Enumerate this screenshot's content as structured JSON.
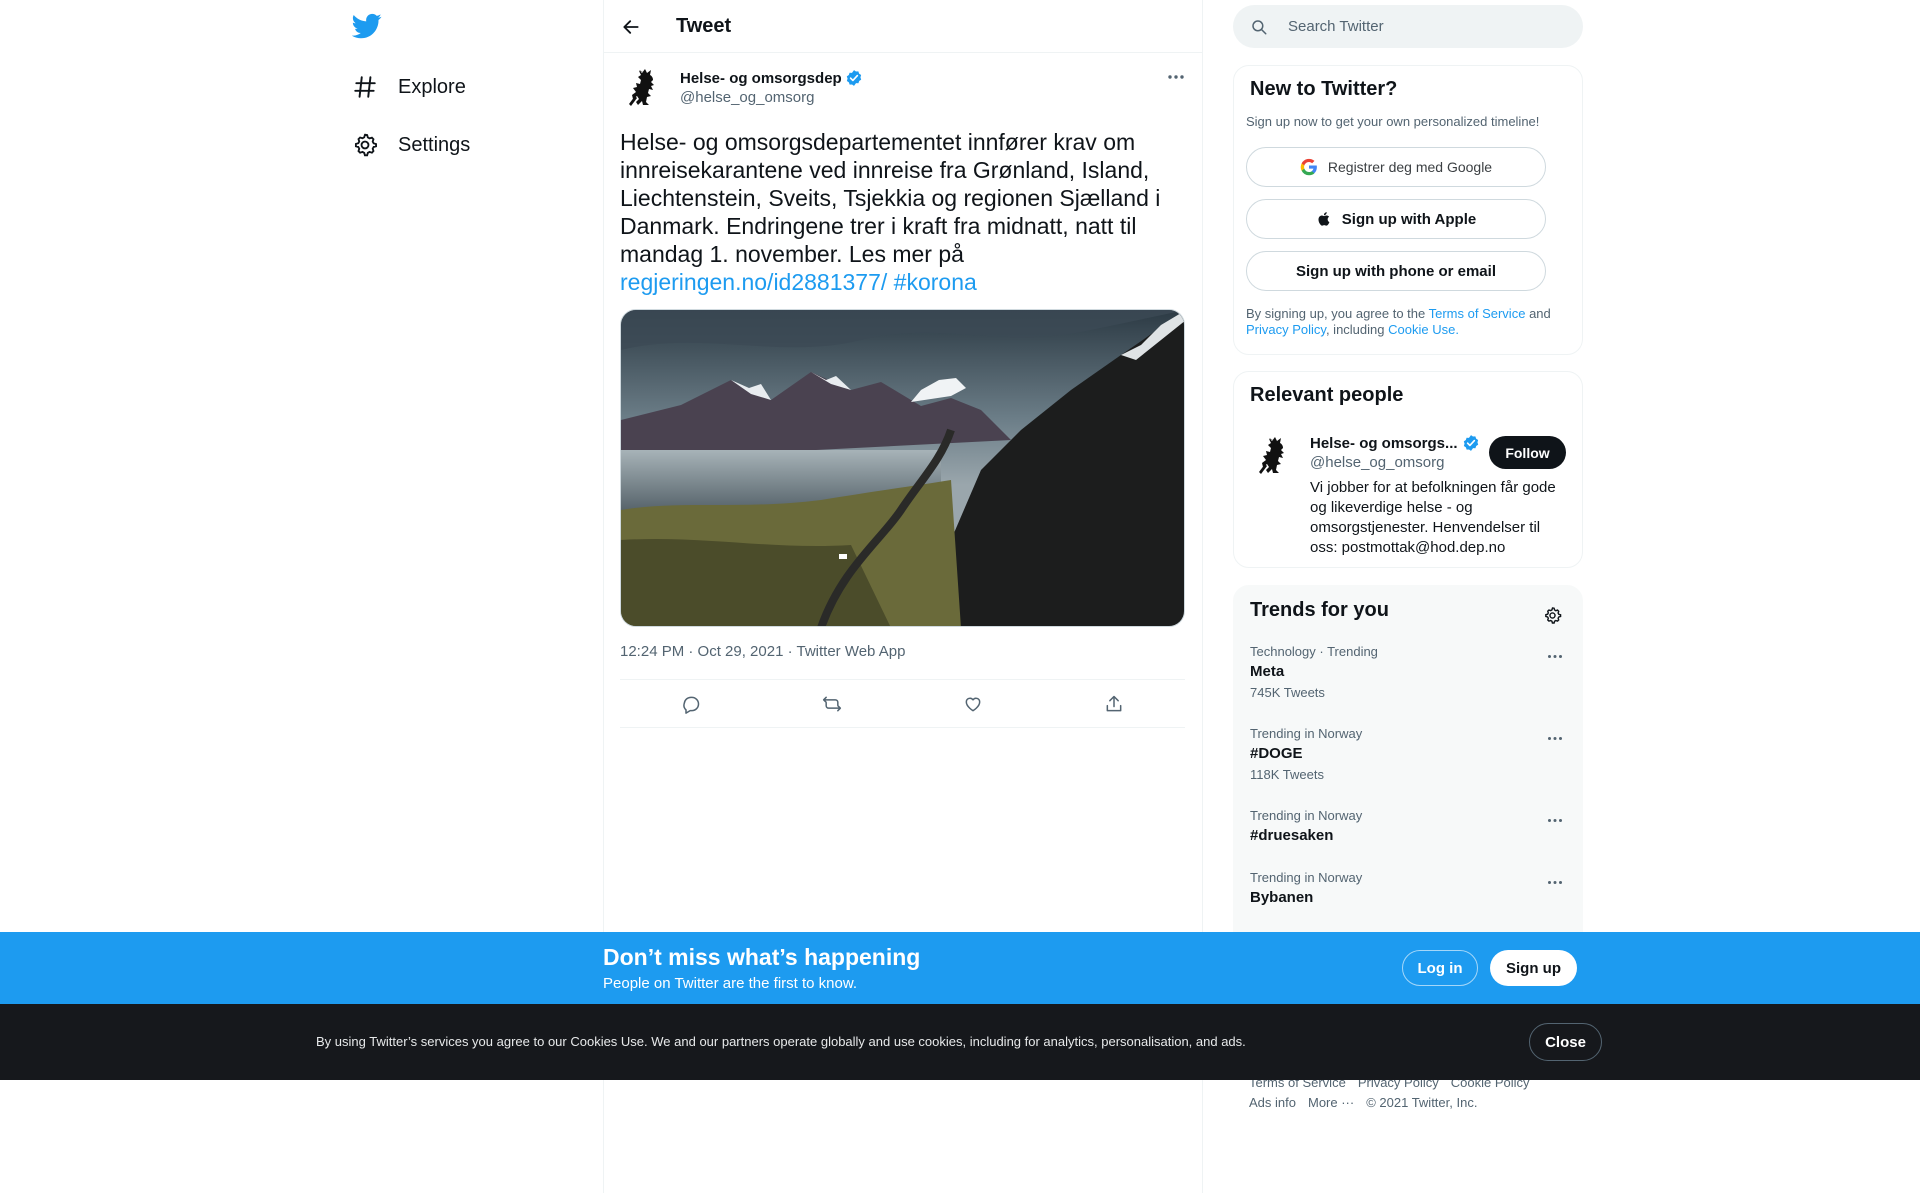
{
  "nav": {
    "items": [
      {
        "label": "Explore",
        "icon": "hashtag-icon"
      },
      {
        "label": "Settings",
        "icon": "gear-icon"
      }
    ]
  },
  "header": {
    "title": "Tweet"
  },
  "tweet": {
    "author_name": "Helse- og omsorgsdep",
    "author_handle": "@helse_og_omsorg",
    "text": "Helse- og omsorgsdepartementet innfører krav om innreisekarantene ved innreise fra Grønland, Island, Liechtenstein, Sveits, Tsjekkia og regionen Sjælland i Danmark. Endringene trer i kraft fra midnatt, natt til mandag 1. november. Les mer på",
    "link": "regjeringen.no/id2881377/",
    "hashtag": "#korona",
    "meta": "12:24 PM · Oct 29, 2021 · Twitter Web App"
  },
  "search": {
    "placeholder": "Search Twitter"
  },
  "new_to_twitter": {
    "title": "New to Twitter?",
    "subtitle": "Sign up now to get your own personalized timeline!",
    "google_label": "Registrer deg med Google",
    "apple_label": "Sign up with Apple",
    "phone_label": "Sign up with phone or email",
    "legal_prefix": "By signing up, you agree to the",
    "terms_link": "Terms of Service",
    "legal_and": "and",
    "privacy_link": "Privacy Policy",
    "legal_including": ", including",
    "cookie_link": "Cookie Use."
  },
  "relevant_people": {
    "title": "Relevant people",
    "name": "Helse- og omsorgs...",
    "handle": "@helse_og_omsorg",
    "follow_label": "Follow",
    "bio": "Vi jobber for at befolkningen får gode og likeverdige helse - og omsorgstjenester. Henvendelser til oss: postmottak@hod.dep.no"
  },
  "trends": {
    "title": "Trends for you",
    "items": [
      {
        "context": "Technology · Trending",
        "name": "Meta",
        "count": "745K Tweets"
      },
      {
        "context": "Trending in Norway",
        "name": "#DOGE",
        "count": "118K Tweets"
      },
      {
        "context": "Trending in Norway",
        "name": "#druesaken",
        "count": ""
      },
      {
        "context": "Trending in Norway",
        "name": "Bybanen",
        "count": ""
      }
    ]
  },
  "footer": {
    "terms": "Terms of Service",
    "privacy": "Privacy Policy",
    "cookie": "Cookie Policy",
    "ads": "Ads info",
    "more": "More ···",
    "copyright": "© 2021 Twitter, Inc."
  },
  "signup_bar": {
    "title": "Don’t miss what’s happening",
    "subtitle": "People on Twitter are the first to know.",
    "login_label": "Log in",
    "signup_label": "Sign up"
  },
  "cookie_bar": {
    "text": "By using Twitter’s services you agree to our Cookies Use. We and our partners operate globally and use cookies, including for analytics, personalisation, and ads.",
    "close_label": "Close"
  },
  "colors": {
    "accent": "#1d9bf0",
    "text": "#0f1419",
    "secondary": "#536471",
    "cookie_bar": "#16181c"
  }
}
